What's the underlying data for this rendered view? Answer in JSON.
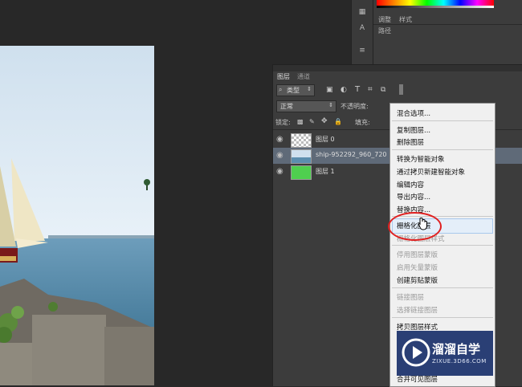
{
  "adjustments_panel": {
    "tabs": [
      "调整",
      "样式"
    ],
    "paths_tab": "路径"
  },
  "layers_panel": {
    "tabs": [
      "图层",
      "通道"
    ],
    "filter_kind": "类型",
    "blend_mode": "正常",
    "opacity_label": "不透明度:",
    "lock_label": "锁定:",
    "fill_label": "填充:",
    "layers": [
      {
        "name": "图层 0",
        "thumb_color": "#888888"
      },
      {
        "name": "ship-952292_960_720",
        "thumb_color": "#7fa3c4"
      },
      {
        "name": "图层 1",
        "thumb_color": "#4fcf4f"
      }
    ]
  },
  "context_menu": {
    "items": [
      {
        "label": "混合选项...",
        "disabled": false
      },
      {
        "label": "复制图层...",
        "disabled": false
      },
      {
        "label": "删除图层",
        "disabled": false
      },
      {
        "label": "转换为智能对象",
        "disabled": false
      },
      {
        "label": "通过拷贝新建智能对象",
        "disabled": false
      },
      {
        "label": "编辑内容",
        "disabled": false
      },
      {
        "label": "导出内容...",
        "disabled": false
      },
      {
        "label": "替换内容...",
        "disabled": false
      },
      {
        "label": "栅格化图层",
        "disabled": false
      },
      {
        "label": "栅格化图层样式",
        "disabled": true
      },
      {
        "label": "停用图层蒙版",
        "disabled": true
      },
      {
        "label": "启用矢量蒙版",
        "disabled": true
      },
      {
        "label": "创建剪贴蒙版",
        "disabled": false
      },
      {
        "label": "链接图层",
        "disabled": true
      },
      {
        "label": "选择链接图层",
        "disabled": true
      },
      {
        "label": "拷贝图层样式",
        "disabled": false
      },
      {
        "label": "合并可见图层",
        "disabled": false
      }
    ]
  },
  "watermark": {
    "title": "溜溜自学",
    "url": "ZIXUE.3D66.COM"
  },
  "colors": {
    "app_bg": "#282828",
    "panel_bg": "#3c3c3c",
    "menu_bg": "#f0f0f0",
    "highlight_circle": "#e02020",
    "watermark_bg": "#2a3f75"
  }
}
